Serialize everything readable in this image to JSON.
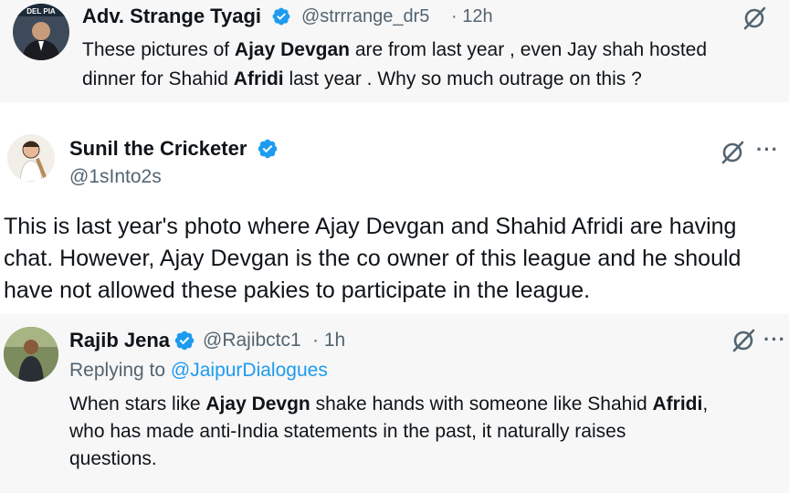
{
  "tweet1": {
    "avatar_text": "DEL  PIA",
    "name": "Adv. Strange Tyagi",
    "handle": "@strrrange_dr5",
    "time": "· 12h",
    "line1": [
      "These pictures of ",
      "Ajay Devgan",
      " are from last year , even Jay shah hosted"
    ],
    "line2": [
      "dinner for Shahid ",
      "Afridi",
      " last year . Why so much outrage on this ?"
    ]
  },
  "tweet2": {
    "name": "Sunil the Cricketer",
    "handle": "@1sInto2s",
    "more": "···",
    "lines": [
      "This is last year's photo where Ajay Devgan and Shahid Afridi are having",
      "chat. However, Ajay Devgan is the co owner of this league and he should",
      "have not allowed these pakies to participate in the league."
    ]
  },
  "tweet3": {
    "name": "Rajib Jena",
    "handle": "@Rajibctc1",
    "time": "· 1h",
    "more": "···",
    "replying_prefix": "Replying to ",
    "replying_handle": "@JaipurDialogues",
    "line1": [
      "When stars like ",
      "Ajay Devgn",
      " shake hands with someone like Shahid ",
      "Afridi",
      ","
    ],
    "line2": "who has made anti-India statements in the past, it naturally raises",
    "line3": "questions."
  },
  "colors": {
    "accent": "#1d9bf0",
    "verified": "#1d9bf0",
    "secondary_text": "#536471"
  }
}
